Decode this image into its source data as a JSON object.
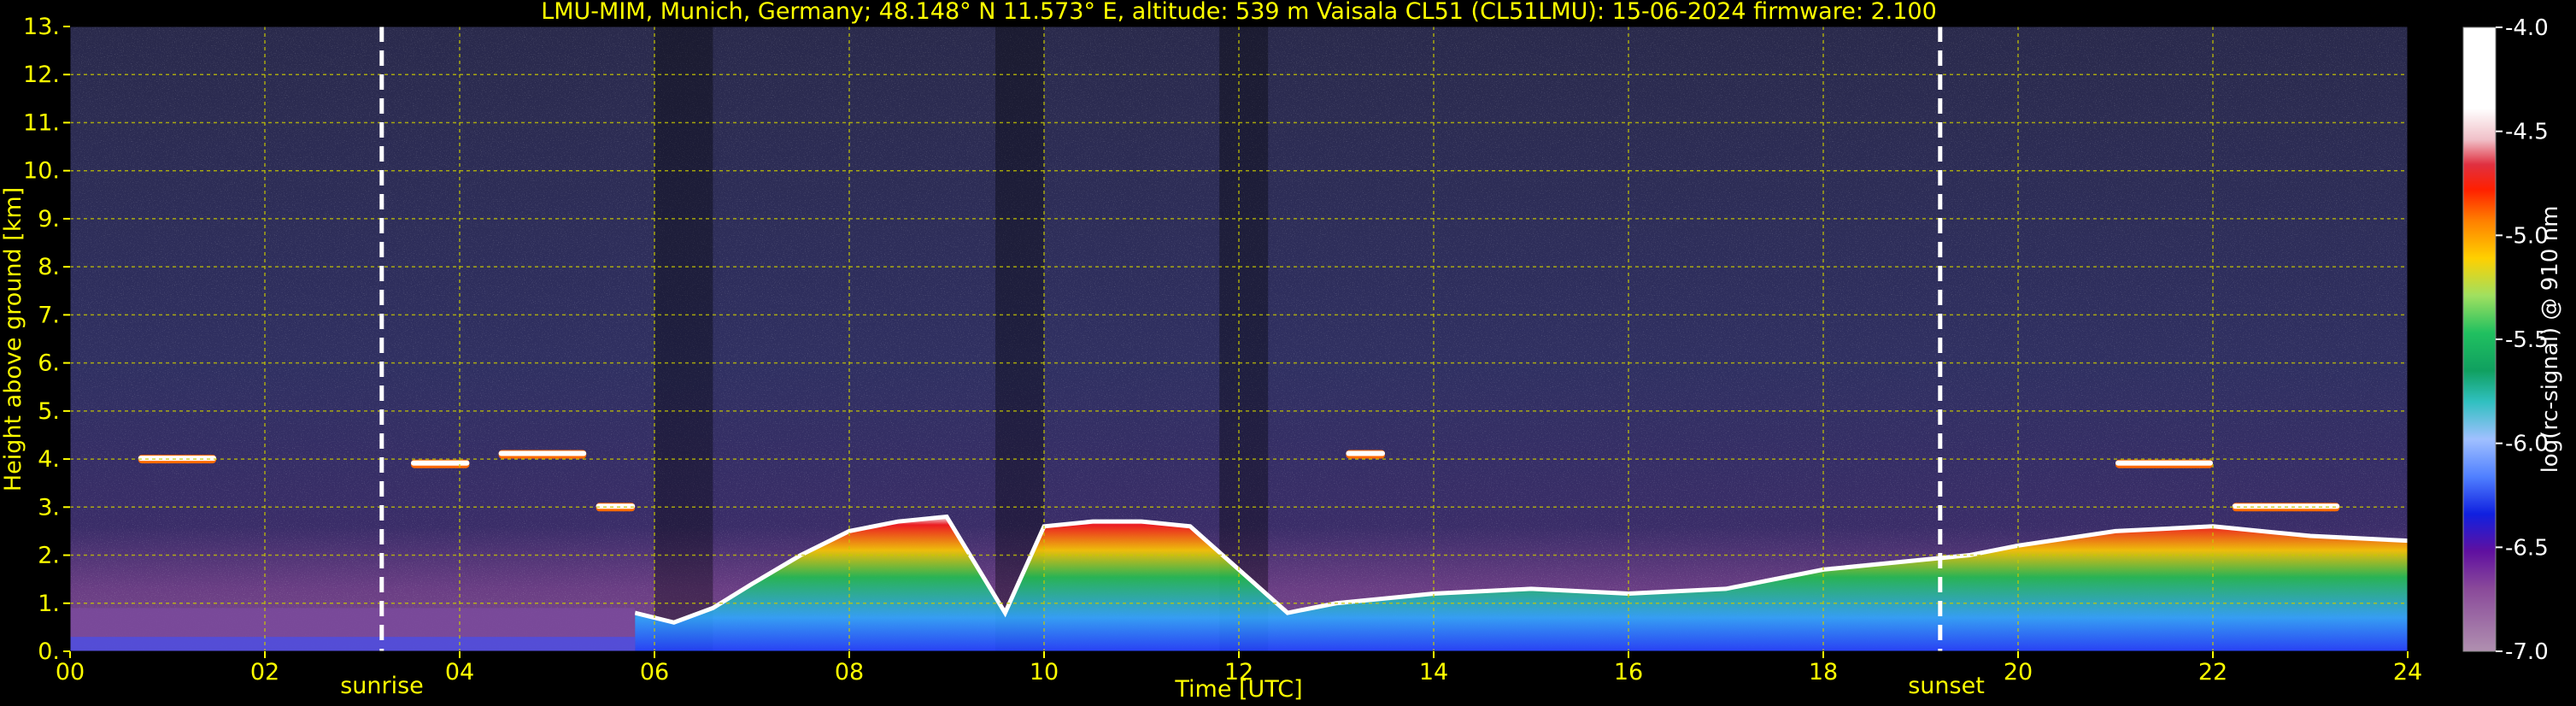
{
  "title": "LMU-MIM, Munich, Germany; 48.148° N 11.573° E, altitude: 539 m    Vaisala CL51 (CL51LMU): 15-06-2024    firmware: 2.100",
  "xlabel": "Time [UTC]",
  "ylabel": "Height above ground [km]",
  "colorbar_label": "log(rc-signal) @ 910 nm",
  "sunrise_label": "sunrise",
  "sunset_label": "sunset",
  "colors": {
    "axis_text": "#ffff00",
    "grid": "#c8c800",
    "event_line": "#ffffff",
    "background": "#000000"
  },
  "chart_data": {
    "type": "heatmap",
    "title": "LMU-MIM, Munich, Germany; 48.148° N 11.573° E, altitude: 539 m    Vaisala CL51 (CL51LMU): 15-06-2024    firmware: 2.100",
    "xlabel": "Time [UTC]",
    "ylabel": "Height above ground [km]",
    "xlim": [
      0,
      24
    ],
    "ylim": [
      0,
      13
    ],
    "xticks": [
      "00",
      "02",
      "04",
      "06",
      "08",
      "10",
      "12",
      "14",
      "16",
      "18",
      "20",
      "22",
      "24"
    ],
    "yticks": [
      "0.",
      "1.",
      "2.",
      "3.",
      "4.",
      "5.",
      "6.",
      "7.",
      "8.",
      "9.",
      "10.",
      "11.",
      "12.",
      "13."
    ],
    "grid": true,
    "events": [
      {
        "label": "sunrise",
        "time_utc": 3.2
      },
      {
        "label": "sunset",
        "time_utc": 19.2
      }
    ],
    "colorbar": {
      "label": "log(rc-signal) @ 910 nm",
      "range": [
        -7.0,
        -4.0
      ],
      "ticks": [
        "-4.0",
        "-4.5",
        "-5.0",
        "-5.5",
        "-6.0",
        "-6.5",
        "-7.0"
      ]
    },
    "features": {
      "boundary_layer_top_km": [
        [
          5.8,
          0.8
        ],
        [
          6.2,
          0.6
        ],
        [
          6.6,
          0.9
        ],
        [
          7.0,
          1.4
        ],
        [
          7.5,
          2.0
        ],
        [
          8.0,
          2.5
        ],
        [
          8.5,
          2.7
        ],
        [
          9.0,
          2.8
        ],
        [
          9.6,
          0.8
        ],
        [
          10.0,
          2.6
        ],
        [
          10.5,
          2.7
        ],
        [
          11.0,
          2.7
        ],
        [
          11.5,
          2.6
        ],
        [
          12.5,
          0.8
        ],
        [
          13.0,
          1.0
        ],
        [
          14.0,
          1.2
        ],
        [
          15.0,
          1.3
        ],
        [
          16.0,
          1.2
        ],
        [
          17.0,
          1.3
        ],
        [
          18.0,
          1.7
        ],
        [
          19.0,
          1.9
        ],
        [
          19.5,
          2.0
        ],
        [
          20.0,
          2.2
        ],
        [
          21.0,
          2.5
        ],
        [
          22.0,
          2.6
        ],
        [
          23.0,
          2.4
        ],
        [
          24.0,
          2.3
        ]
      ],
      "cloud_layers": [
        {
          "t_start": 0.7,
          "t_end": 1.5,
          "height_km": 4.0
        },
        {
          "t_start": 3.5,
          "t_end": 4.1,
          "height_km": 3.9
        },
        {
          "t_start": 4.4,
          "t_end": 5.3,
          "height_km": 4.1
        },
        {
          "t_start": 5.4,
          "t_end": 5.8,
          "height_km": 3.0
        },
        {
          "t_start": 13.1,
          "t_end": 13.5,
          "height_km": 4.1
        },
        {
          "t_start": 21.0,
          "t_end": 22.0,
          "height_km": 3.9
        },
        {
          "t_start": 22.2,
          "t_end": 23.3,
          "height_km": 3.0
        }
      ]
    }
  }
}
